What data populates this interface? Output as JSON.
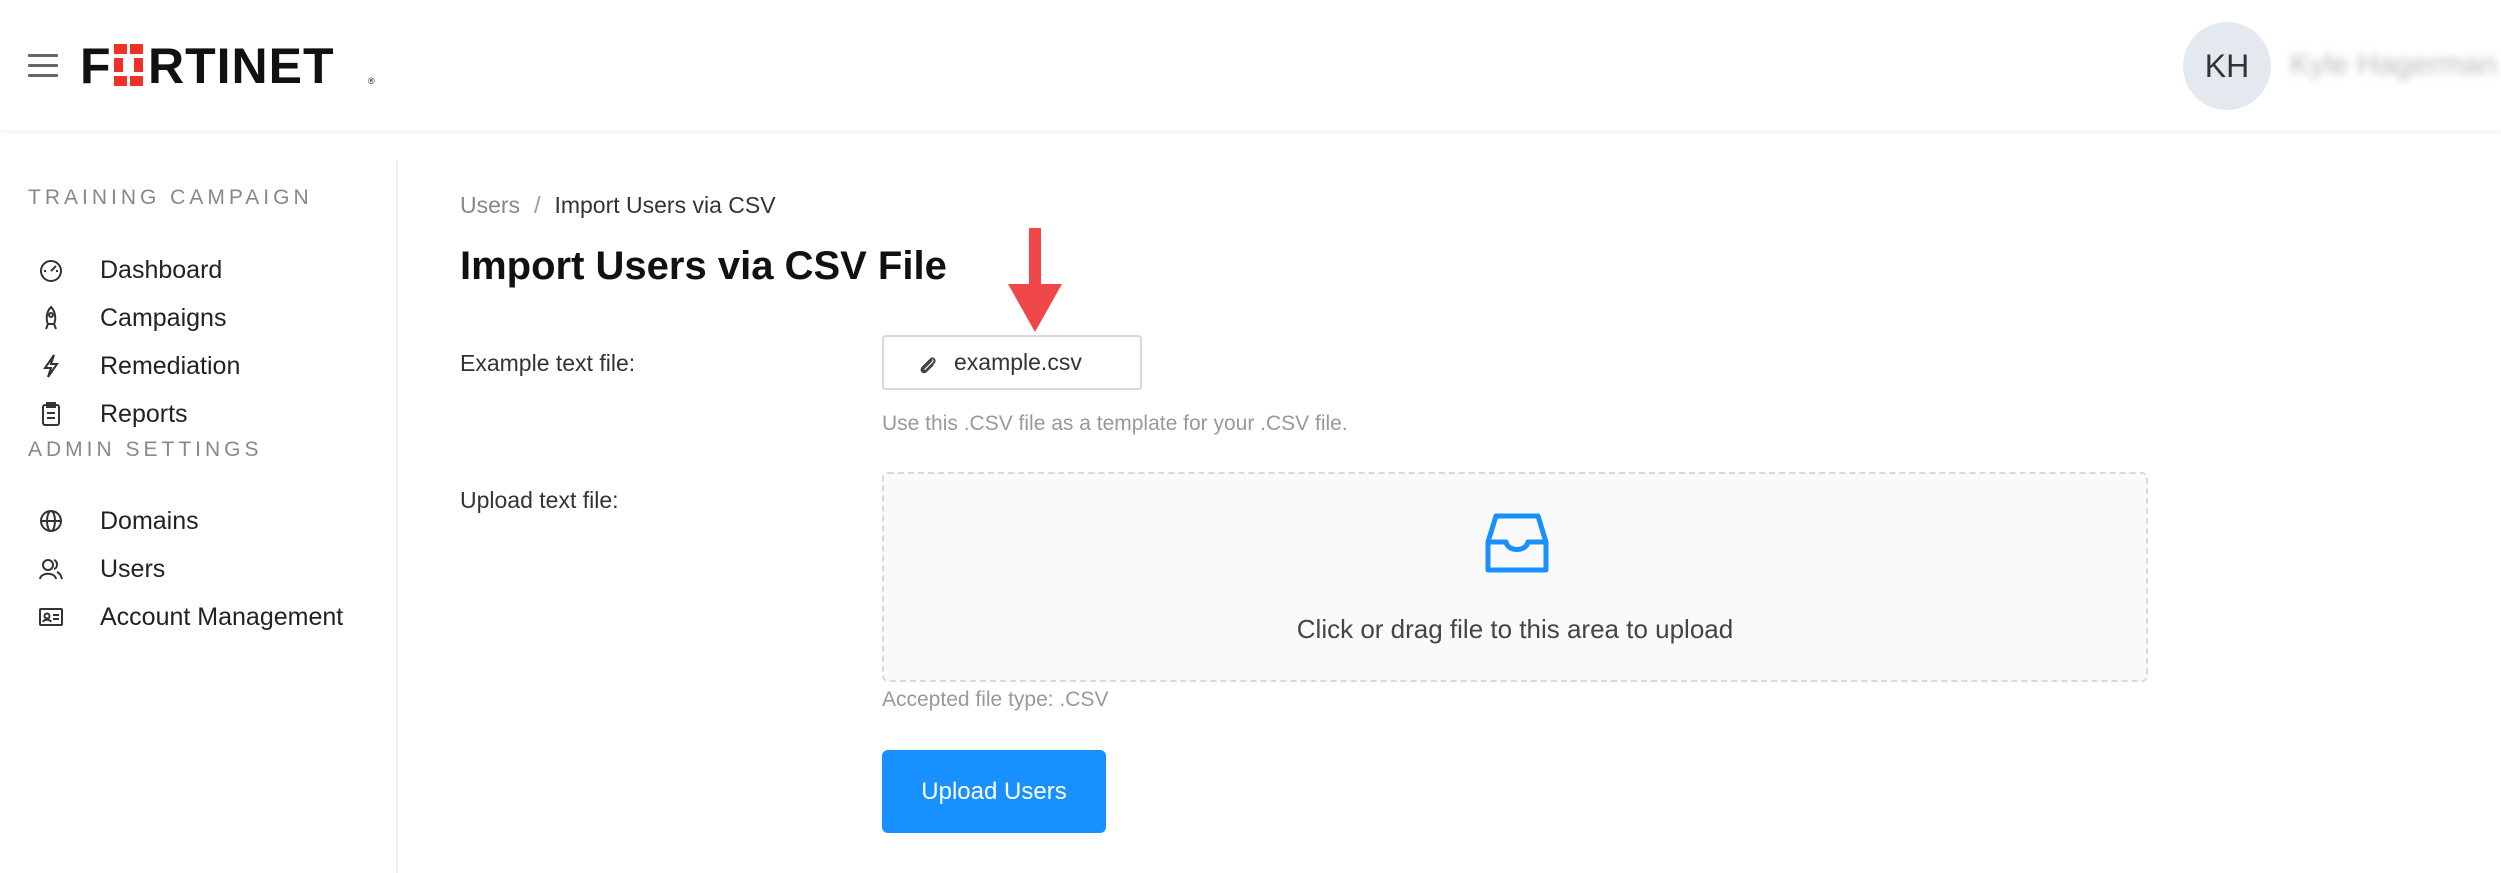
{
  "header": {
    "brand": "FORTINET",
    "avatar_initials": "KH",
    "user_name": "Kyle Hagerman"
  },
  "sidebar": {
    "section_training": "TRAINING CAMPAIGN",
    "section_admin": "ADMIN SETTINGS",
    "training_items": [
      {
        "label": "Dashboard",
        "icon": "dashboard-icon"
      },
      {
        "label": "Campaigns",
        "icon": "rocket-icon"
      },
      {
        "label": "Remediation",
        "icon": "thunderbolt-icon"
      },
      {
        "label": "Reports",
        "icon": "clipboard-icon"
      }
    ],
    "admin_items": [
      {
        "label": "Domains",
        "icon": "globe-icon"
      },
      {
        "label": "Users",
        "icon": "users-icon"
      },
      {
        "label": "Account Management",
        "icon": "id-card-icon"
      }
    ]
  },
  "breadcrumb": {
    "parent": "Users",
    "separator": "/",
    "current": "Import Users via CSV"
  },
  "page": {
    "title": "Import Users via CSV File",
    "example_label": "Example text file:",
    "example_file": "example.csv",
    "example_help": "Use this .CSV file as a template for your .CSV file.",
    "upload_label": "Upload text file:",
    "dropzone_hint": "Click or drag file to this area to upload",
    "accepted_help": "Accepted file type: .CSV",
    "upload_button": "Upload Users"
  },
  "colors": {
    "brand_red": "#ee3124",
    "primary_blue": "#1890ff",
    "arrow_red": "#f04848"
  }
}
